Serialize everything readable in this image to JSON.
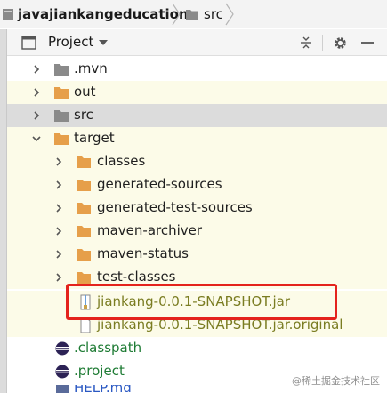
{
  "breadcrumb": {
    "project": "javajiankangeducation",
    "folder": "src"
  },
  "panel": {
    "title": "Project",
    "icons": [
      "project-view-icon",
      "dropdown-caret-icon",
      "collapse-all-icon",
      "gear-icon",
      "minimize-icon"
    ]
  },
  "tree": {
    "items": [
      {
        "label": ".mvn",
        "type": "folder-gray"
      },
      {
        "label": "out",
        "type": "folder-orange"
      },
      {
        "label": "src",
        "type": "folder-gray"
      },
      {
        "label": "target",
        "type": "folder-orange"
      },
      {
        "label": "classes",
        "type": "folder-orange"
      },
      {
        "label": "generated-sources",
        "type": "folder-orange"
      },
      {
        "label": "generated-test-sources",
        "type": "folder-orange"
      },
      {
        "label": "maven-archiver",
        "type": "folder-orange"
      },
      {
        "label": "maven-status",
        "type": "folder-orange"
      },
      {
        "label": "test-classes",
        "type": "folder-orange"
      },
      {
        "label": "jiankang-0.0.1-SNAPSHOT.jar",
        "type": "jar"
      },
      {
        "label": "jiankang-0.0.1-SNAPSHOT.jar.original",
        "type": "file"
      },
      {
        "label": ".classpath",
        "type": "eclipse"
      },
      {
        "label": ".project",
        "type": "eclipse"
      },
      {
        "label": "HELP.md",
        "type": "md"
      }
    ]
  },
  "watermark": "@稀土掘金技术社区",
  "colors": {
    "accent_red": "#e4231d",
    "folder_orange": "#e69f4a",
    "folder_gray": "#8a8a8a",
    "green_text": "#1e7b34",
    "olive_text": "#7a7c21"
  }
}
